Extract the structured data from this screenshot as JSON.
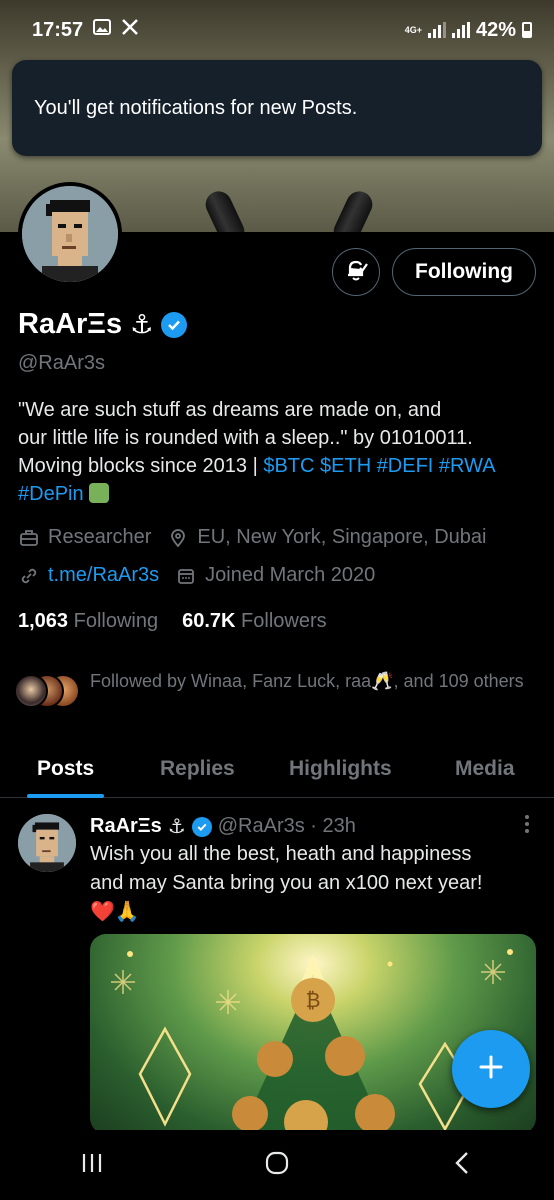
{
  "status_bar": {
    "time": "17:57",
    "network": "4G+",
    "battery": "42%"
  },
  "toast": {
    "message": "You'll get notifications for new Posts."
  },
  "profile": {
    "following_button": "Following",
    "name": "RaArΞs",
    "anchor": "⚓",
    "handle": "@RaAr3s",
    "bio_line1": "\"We are such stuff as dreams are made on, and",
    "bio_line2": "our little life is rounded with a sleep..\" by 01010011.",
    "bio_line3": "Moving blocks since 2013 | ",
    "bio_tags_line3": "$BTC $ETH #DEFI #RWA",
    "bio_tags_line4": "#DePin",
    "profession": "Researcher",
    "location": "EU, New York, Singapore, Dubai",
    "link": "t.me/RaAr3s",
    "joined": "Joined March 2020",
    "following_count": "1,063",
    "following_label": "Following",
    "followers_count": "60.7K",
    "followers_label": "Followers",
    "followed_by": "Followed by Winaa, Fanz Luck, raa🥂, and 109 others"
  },
  "tabs": [
    {
      "label": "Posts"
    },
    {
      "label": "Replies"
    },
    {
      "label": "Highlights"
    },
    {
      "label": "Media"
    }
  ],
  "post": {
    "name": "RaArΞs",
    "anchor": "⚓",
    "meta": "@RaAr3s · 23h",
    "text_line1": "Wish you all the best, heath and happiness",
    "text_line2": "and may Santa bring you an x100 next year!",
    "emojis": "❤️🙏"
  },
  "colors": {
    "accent": "#1d9bf0",
    "background": "#000000",
    "muted": "#71767b",
    "toast_bg": "#15202b"
  },
  "icons": [
    "bell-subscribed-icon",
    "verified-badge-icon",
    "briefcase-icon",
    "location-pin-icon",
    "link-icon",
    "calendar-icon",
    "plus-icon",
    "recents-icon",
    "home-icon",
    "back-icon"
  ]
}
